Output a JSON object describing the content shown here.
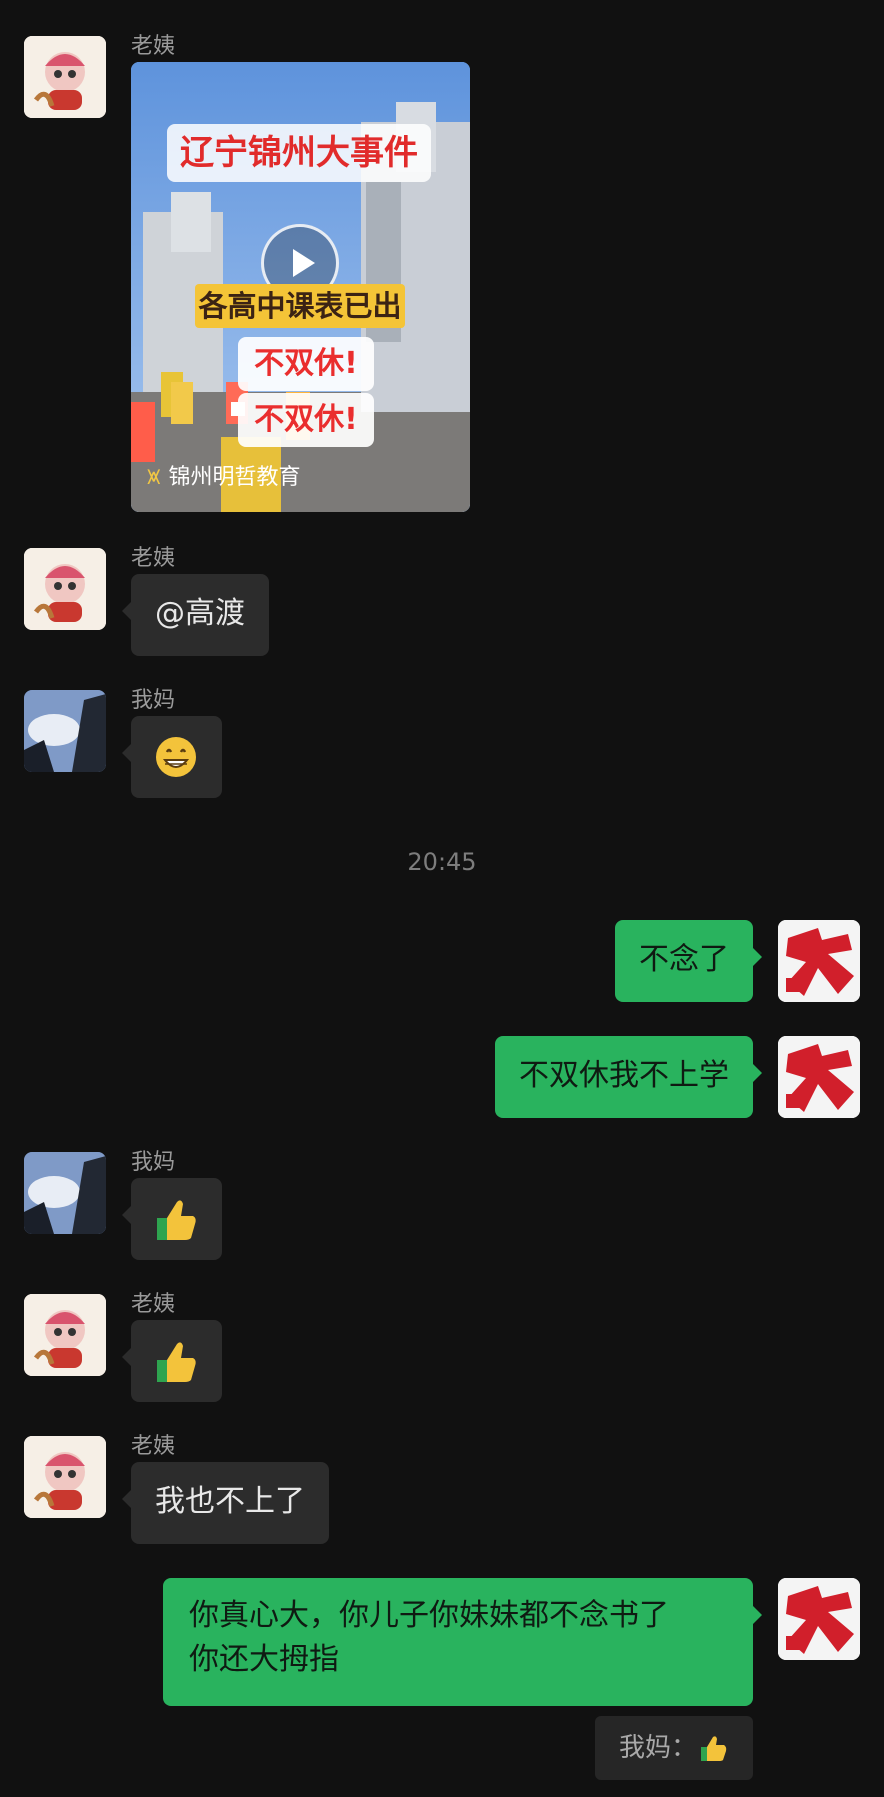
{
  "messages": [
    {
      "sender": "老姨"
    },
    {
      "sender": "老姨",
      "text": "@高渡"
    },
    {
      "sender": "我妈",
      "emoji": "grinning-face"
    },
    {
      "text": "不念了"
    },
    {
      "text": "不双休我不上学"
    },
    {
      "sender": "我妈",
      "emoji": "thumbs-up"
    },
    {
      "sender": "老姨",
      "emoji": "thumbs-up"
    },
    {
      "sender": "老姨",
      "text": "我也不上了"
    },
    {
      "text_line1": "你真心大，你儿子你妹妹都不念书了",
      "text_line2": "你还大拇指"
    }
  ],
  "timestamp": "20:45",
  "video": {
    "banner": "辽宁锦州大事件",
    "caption1": "各高中课表已出",
    "caption2": "不双休!",
    "caption3": "不双休!",
    "brand": "锦州明哲教育"
  },
  "quote": {
    "text": "我妈：",
    "emoji": "thumbs-up"
  },
  "colors": {
    "background": "#111111",
    "incoming_bubble": "#2c2c2c",
    "outgoing_bubble": "#29b35e",
    "timestamp": "#7d7d7d"
  }
}
